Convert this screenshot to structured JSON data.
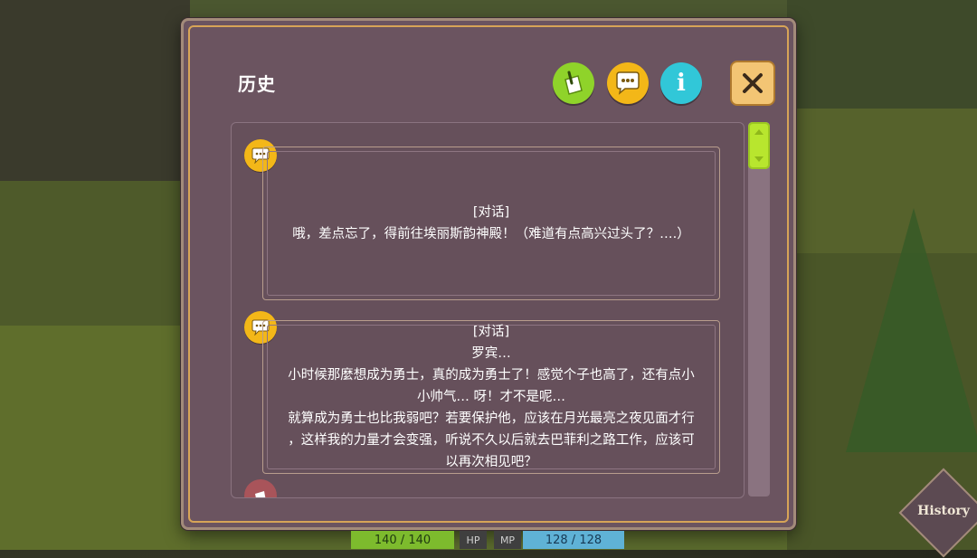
{
  "window": {
    "title": "历史"
  },
  "toolbar": {
    "note_icon": "note-icon",
    "chat_icon": "speech-bubble-icon",
    "info_label": "i",
    "close_icon": "close-icon"
  },
  "log": {
    "entries": [
      {
        "type_label": "[对话]",
        "speaker": "",
        "text": "哦，差点忘了，得前往埃丽斯韵神殿！（难道有点高兴过头了？….）"
      },
      {
        "type_label": "[对话]",
        "speaker": "罗宾…",
        "lines": [
          "小时候那麼想成为勇士，真的成为勇士了！感觉个子也高了，还有点小",
          "小帅气… 呀！才不是呢…",
          "就算成为勇士也比我弱吧？若要保护他，应该在月光最亮之夜见面才行",
          "，这样我的力量才会变强，听说不久以后就去巴菲利之路工作，应该可",
          "以再次相见吧？"
        ]
      }
    ]
  },
  "hud": {
    "hp_value": "140 / 140",
    "hp_label": "HP",
    "mp_label": "MP",
    "mp_value": "128 / 128"
  },
  "history_button": {
    "label": "History"
  },
  "colors": {
    "panel": "#6b5460",
    "accent_gold": "#d7a457",
    "chat_yellow": "#f3b718",
    "note_green": "#8fd32a",
    "info_cyan": "#31c7d8",
    "scroll_thumb": "#b8e62e"
  }
}
